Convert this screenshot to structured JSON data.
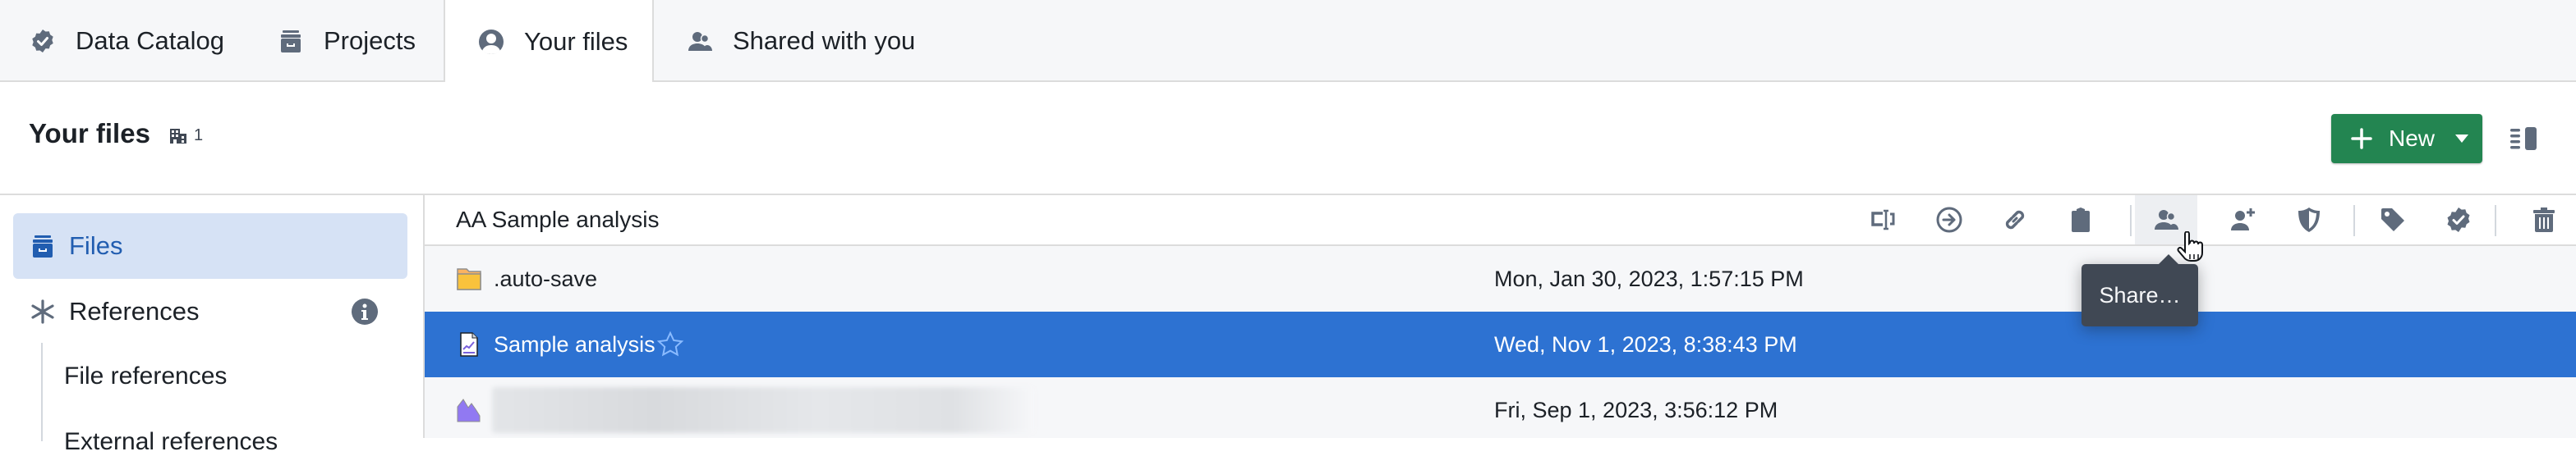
{
  "tabs": [
    {
      "label": "Data Catalog",
      "icon": "badge-check-icon",
      "active": false
    },
    {
      "label": "Projects",
      "icon": "archive-icon",
      "active": false
    },
    {
      "label": "Your files",
      "icon": "user-icon",
      "active": true
    },
    {
      "label": "Shared with you",
      "icon": "people-icon",
      "active": false
    }
  ],
  "header": {
    "title": "Your files",
    "org_count": "1",
    "new_button_label": "New"
  },
  "sidebar": {
    "items": [
      {
        "label": "Files",
        "icon": "archive-icon",
        "active": true
      },
      {
        "label": "References",
        "icon": "asterisk-icon",
        "active": false
      }
    ],
    "sub_items": [
      {
        "label": "File references"
      },
      {
        "label": "External references"
      }
    ]
  },
  "content": {
    "breadcrumb": "AA Sample analysis",
    "toolbar": [
      {
        "name": "rename",
        "icon": "rename-icon"
      },
      {
        "name": "move",
        "icon": "arrow-circle-right-icon"
      },
      {
        "name": "copy-link",
        "icon": "link-icon"
      },
      {
        "name": "copy",
        "icon": "clipboard-icon"
      },
      {
        "name": "share",
        "icon": "people-icon",
        "hovered": true
      },
      {
        "name": "request-access",
        "icon": "add-user-icon"
      },
      {
        "name": "permissions",
        "icon": "shield-icon"
      },
      {
        "name": "tags",
        "icon": "tag-icon"
      },
      {
        "name": "endorse",
        "icon": "badge-check-icon"
      },
      {
        "name": "delete",
        "icon": "trash-icon"
      }
    ],
    "tooltip": "Share…",
    "rows": [
      {
        "name": ".auto-save",
        "icon": "folder-icon",
        "date": "Mon, Jan 30, 2023, 1:57:15 PM",
        "selected": false
      },
      {
        "name": "Sample analysis",
        "icon": "analysis-file-icon",
        "date": "Wed, Nov 1, 2023, 8:38:43 PM",
        "selected": true,
        "starred": false
      },
      {
        "name": "",
        "icon": "contour-icon",
        "date": "Fri, Sep 1, 2023, 3:56:12 PM",
        "selected": false,
        "name_redacted": true
      }
    ]
  },
  "colors": {
    "accent": "#2d72d2",
    "primary_button": "#238551",
    "icon_gray": "#5f6b7c",
    "sidebar_active_bg": "#d6e2f5",
    "tooltip_bg": "#404854"
  }
}
